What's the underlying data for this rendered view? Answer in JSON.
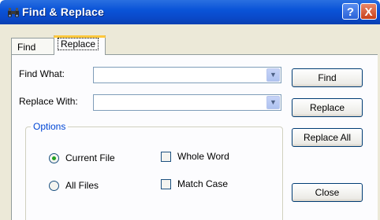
{
  "window": {
    "title": "Find & Replace"
  },
  "title_buttons": {
    "help": "?",
    "close": "X"
  },
  "tabs": [
    {
      "label": "Find"
    },
    {
      "label": "Replace"
    }
  ],
  "find_what": {
    "label": "Find What:",
    "value": ""
  },
  "replace_with": {
    "label": "Replace With:",
    "value": ""
  },
  "buttons": {
    "find": "Find",
    "replace": "Replace",
    "replace_all": "Replace All",
    "close": "Close"
  },
  "options": {
    "legend": "Options",
    "scope": {
      "current_file": "Current File",
      "all_files": "All Files",
      "selected": "current_file"
    },
    "whole_word": {
      "label": "Whole Word",
      "checked": false
    },
    "match_case": {
      "label": "Match Case",
      "checked": false
    }
  },
  "colors": {
    "titlebar": "#0a54d8",
    "accent_tab": "#ffc83c",
    "legend": "#0046d5",
    "radio_dot": "#21a121"
  }
}
